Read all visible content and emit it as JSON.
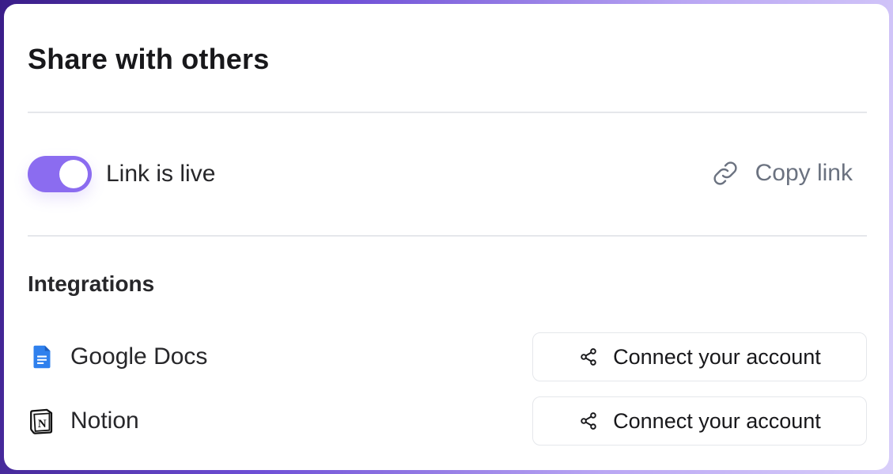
{
  "dialog": {
    "title": "Share with others"
  },
  "link": {
    "toggle_on": true,
    "toggle_label": "Link is live",
    "copy_label": "Copy link",
    "copy_icon": "link-icon"
  },
  "integrations": {
    "heading": "Integrations",
    "items": [
      {
        "name": "Google Docs",
        "icon": "google-docs-icon",
        "button_label": "Connect your account",
        "button_icon": "share-icon"
      },
      {
        "name": "Notion",
        "icon": "notion-icon",
        "button_label": "Connect your account",
        "button_icon": "share-icon"
      }
    ]
  },
  "colors": {
    "accent": "#8b6cf0",
    "text": "#18181b",
    "muted": "#6b7280",
    "divider": "#e5e7eb",
    "google_docs_blue": "#2f80ed"
  }
}
